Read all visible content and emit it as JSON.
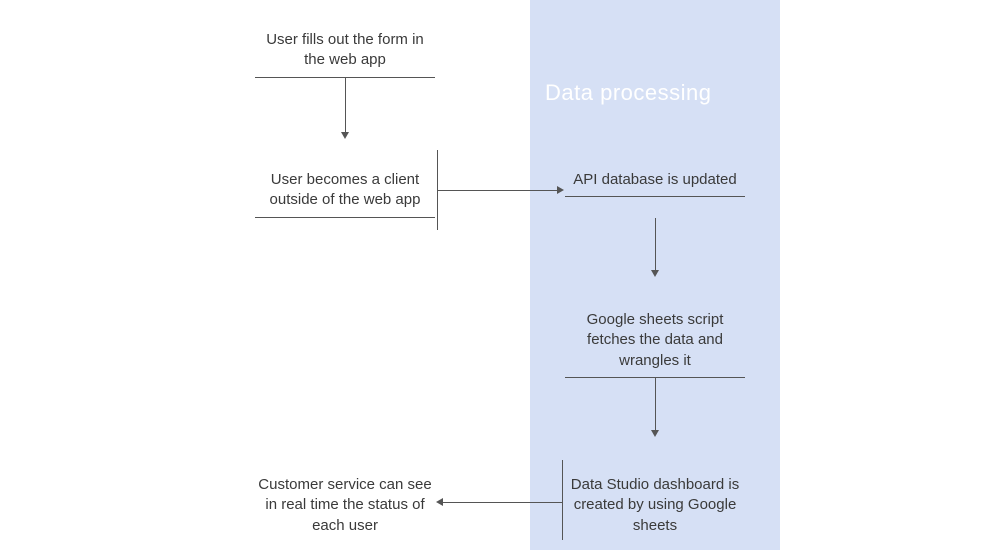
{
  "panel": {
    "title": "Data processing",
    "bg": "#d6e0f5",
    "title_color": "#ffffff"
  },
  "nodes": {
    "form": "User fills out the form in the web app",
    "client": "User becomes a client outside of the web app",
    "api": "API database is updated",
    "sheets_script": "Google sheets script fetches the data and wrangles it",
    "dashboard": "Data Studio dashboard is created by using Google sheets",
    "customer_service": "Customer service can see in real time the status of each user"
  },
  "flow": [
    {
      "from": "form",
      "to": "client",
      "dir": "down"
    },
    {
      "from": "client",
      "to": "api",
      "dir": "right"
    },
    {
      "from": "api",
      "to": "sheets_script",
      "dir": "down"
    },
    {
      "from": "sheets_script",
      "to": "dashboard",
      "dir": "down"
    },
    {
      "from": "dashboard",
      "to": "customer_service",
      "dir": "left"
    }
  ]
}
